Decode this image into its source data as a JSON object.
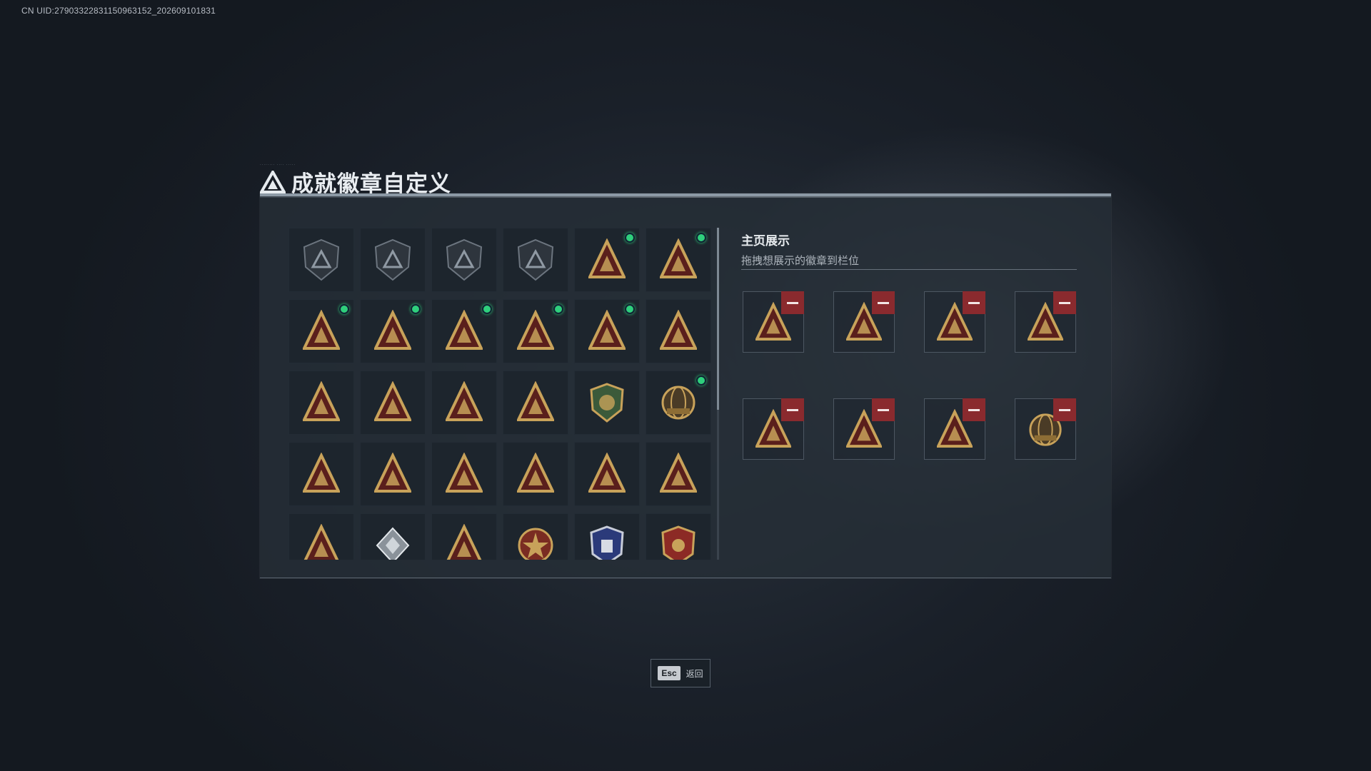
{
  "uid_text": "CN UID:279033228311509631​52_202609101831",
  "title": "成就徽章自定义",
  "colors": {
    "accent_green": "#2fcf7c",
    "remove_red": "#8a2a2e",
    "gold": "#c8a25a",
    "panel": "#262e37"
  },
  "badges": [
    {
      "icon": "grey-shield-triangle-badge",
      "new": false
    },
    {
      "icon": "grey-shield-helicopter-badge",
      "new": false
    },
    {
      "icon": "grey-shield-diamond-badge",
      "new": false
    },
    {
      "icon": "grey-shield-eagle-badge",
      "new": false
    },
    {
      "icon": "gold-triangle-s5-badge",
      "new": true
    },
    {
      "icon": "gold-triangle-s6-badge",
      "new": true
    },
    {
      "icon": "gold-triangle-crate-badge",
      "new": true
    },
    {
      "icon": "gold-triangle-sb-badge",
      "new": true
    },
    {
      "icon": "gold-triangle-tank-badge",
      "new": true
    },
    {
      "icon": "gold-triangle-gear-badge",
      "new": true
    },
    {
      "icon": "gold-triangle-beta-badge",
      "new": true
    },
    {
      "icon": "gold-triangle-pear-badge",
      "new": false
    },
    {
      "icon": "gold-triangle-trophy-badge",
      "new": false
    },
    {
      "icon": "gold-triangle-bowl-badge",
      "new": false
    },
    {
      "icon": "gold-triangle-rifle-badge",
      "new": false
    },
    {
      "icon": "gold-triangle-number-one-badge",
      "new": false
    },
    {
      "icon": "green-shield-operator-badge",
      "new": false
    },
    {
      "icon": "gold-globe-2025-badge",
      "new": true
    },
    {
      "icon": "gold-triangle-bottle-badge",
      "new": false
    },
    {
      "icon": "gold-triangle-canister-badge",
      "new": false
    },
    {
      "icon": "gold-triangle-soldier-badge",
      "new": false
    },
    {
      "icon": "gold-triangle-crest-badge",
      "new": false
    },
    {
      "icon": "gold-triangle-wings-badge",
      "new": false
    },
    {
      "icon": "gold-triangle-squad-badge",
      "new": false
    },
    {
      "icon": "gold-triangle-arm-badge",
      "new": false
    },
    {
      "icon": "silver-diamond-badge",
      "new": false
    },
    {
      "icon": "gold-triangle-figure-badge",
      "new": false
    },
    {
      "icon": "red-star-medal-badge",
      "new": false
    },
    {
      "icon": "blue-shield-badge",
      "new": false
    },
    {
      "icon": "red-gold-shield-badge",
      "new": false
    }
  ],
  "showcase": {
    "title": "主页展示",
    "subtitle": "拖拽想展示的徽章到栏位",
    "slots": [
      {
        "icon": "gold-triangle-s5-badge"
      },
      {
        "icon": "gold-triangle-s6-badge"
      },
      {
        "icon": "gold-triangle-crate-badge"
      },
      {
        "icon": "gold-triangle-sb-badge"
      },
      {
        "icon": "gold-triangle-tank-badge"
      },
      {
        "icon": "gold-triangle-gear-badge"
      },
      {
        "icon": "gold-triangle-beta-badge"
      },
      {
        "icon": "gold-globe-2025-badge"
      }
    ]
  },
  "footer": {
    "esc_key": "Esc",
    "back_label": "返回"
  }
}
